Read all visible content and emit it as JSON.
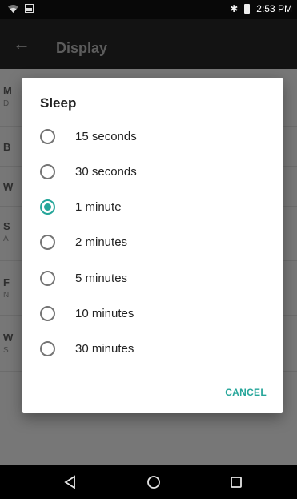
{
  "status": {
    "time": "2:53 PM",
    "bluetooth_glyph": "✱"
  },
  "app_bar": {
    "title": "Display",
    "back_glyph": "←"
  },
  "background_rows": [
    {
      "letter": "M",
      "sub": "D"
    },
    {
      "letter": "B",
      "sub": ""
    },
    {
      "letter": "W",
      "sub": ""
    },
    {
      "letter": "S",
      "sub": "A"
    },
    {
      "letter": "F",
      "sub": "N"
    },
    {
      "letter": "W",
      "sub": "S"
    }
  ],
  "dialog": {
    "title": "Sleep",
    "options": [
      {
        "label": "15 seconds",
        "selected": false
      },
      {
        "label": "30 seconds",
        "selected": false
      },
      {
        "label": "1 minute",
        "selected": true
      },
      {
        "label": "2 minutes",
        "selected": false
      },
      {
        "label": "5 minutes",
        "selected": false
      },
      {
        "label": "10 minutes",
        "selected": false
      },
      {
        "label": "30 minutes",
        "selected": false
      }
    ],
    "cancel_label": "CANCEL"
  },
  "colors": {
    "accent": "#26a69a",
    "scrim": "#777777"
  },
  "icons": {
    "nav_back": "triangle-back-icon",
    "nav_home": "circle-home-icon",
    "nav_recents": "square-recents-icon"
  }
}
